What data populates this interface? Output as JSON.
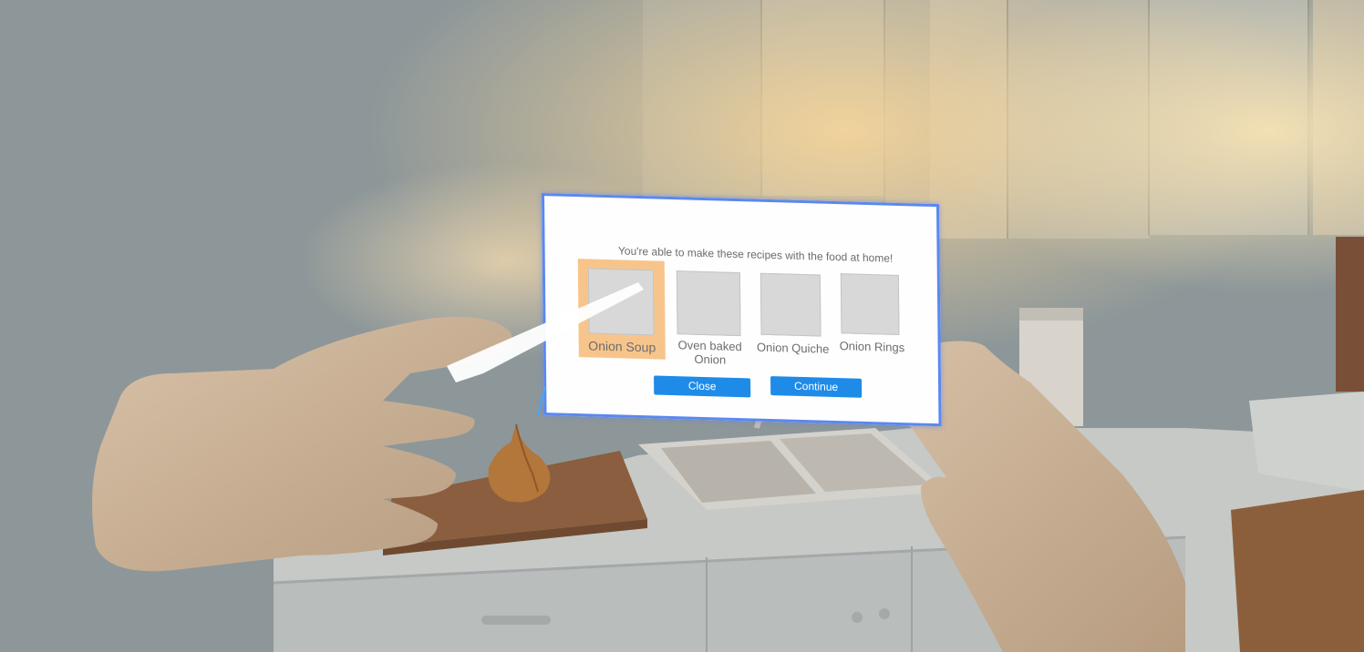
{
  "dialog": {
    "prompt": "You're able to make these recipes with the food at home!",
    "recipes": [
      {
        "label": "Onion Soup",
        "selected": true
      },
      {
        "label": "Oven baked Onion",
        "selected": false
      },
      {
        "label": "Onion Quiche",
        "selected": false
      },
      {
        "label": "Onion Rings",
        "selected": false
      }
    ],
    "close_label": "Close",
    "continue_label": "Continue"
  },
  "colors": {
    "panel_border": "#5b88f0",
    "selected_tile": "#f7c58c",
    "button": "#1e8be8"
  }
}
